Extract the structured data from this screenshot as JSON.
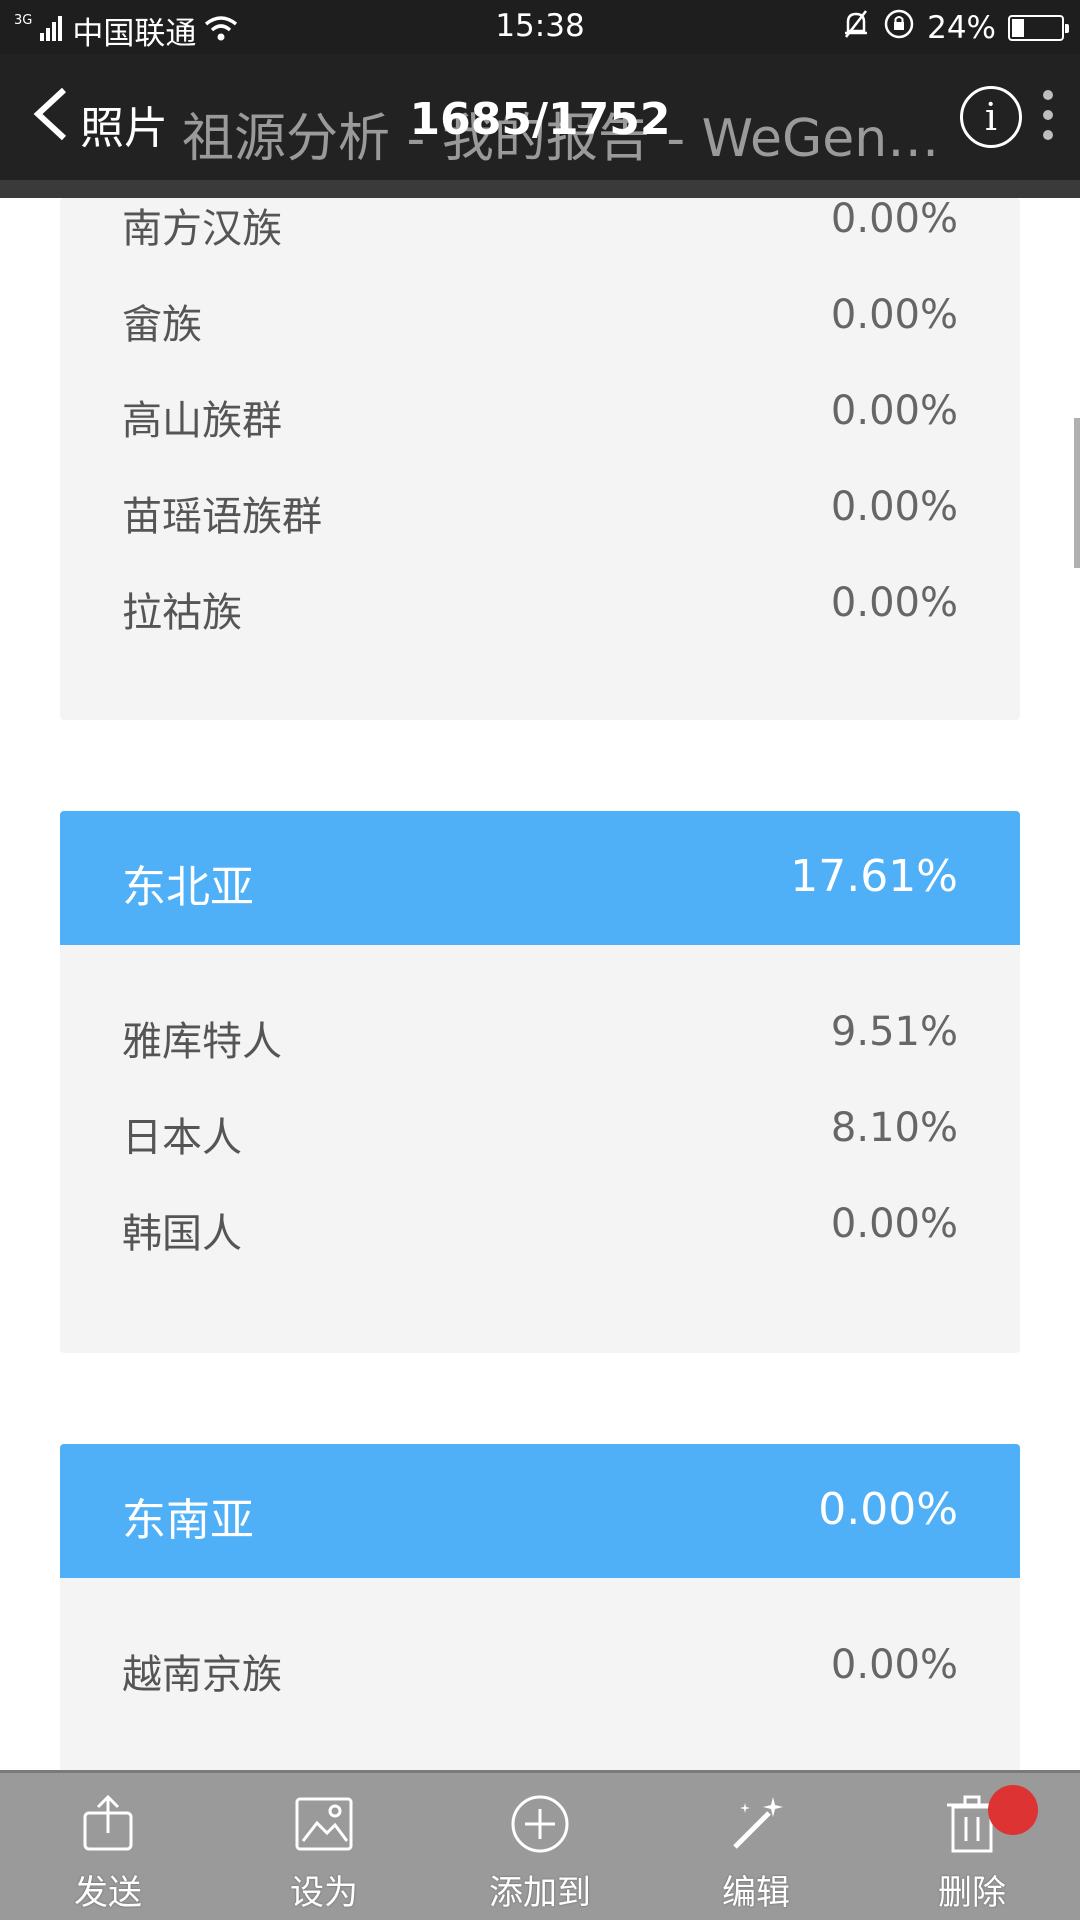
{
  "status_bar": {
    "network_type": "3G",
    "carrier": "中国联通",
    "time": "15:38",
    "battery": "24%",
    "battery_level": 0.24
  },
  "viewer": {
    "back_label": "照片",
    "page_title": "祖源分析 - 我的报告 - WeGene...",
    "counter": "1685/1752",
    "info_label": "i"
  },
  "sections": [
    {
      "rows": [
        {
          "name": "南方汉族",
          "pct": "0.00%"
        },
        {
          "name": "畲族",
          "pct": "0.00%"
        },
        {
          "name": "高山族群",
          "pct": "0.00%"
        },
        {
          "name": "苗瑶语族群",
          "pct": "0.00%"
        },
        {
          "name": "拉祜族",
          "pct": "0.00%"
        }
      ]
    },
    {
      "title": "东北亚",
      "pct": "17.61%",
      "rows": [
        {
          "name": "雅库特人",
          "pct": "9.51%"
        },
        {
          "name": "日本人",
          "pct": "8.10%"
        },
        {
          "name": "韩国人",
          "pct": "0.00%"
        }
      ]
    },
    {
      "title": "东南亚",
      "pct": "0.00%",
      "rows": [
        {
          "name": "越南京族",
          "pct": "0.00%"
        }
      ]
    }
  ],
  "toolbar": {
    "send": "发送",
    "set_as": "设为",
    "add_to": "添加到",
    "edit": "编辑",
    "delete": "删除"
  },
  "colors": {
    "section_header": "#4faff7",
    "card_background": "#f4f4f4",
    "toolbar": "#9a9a9a"
  }
}
